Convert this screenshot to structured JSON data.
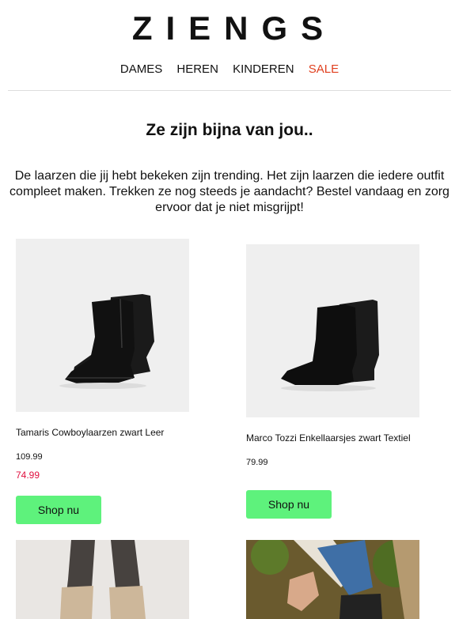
{
  "brand": {
    "logo": "ZIENGS"
  },
  "nav": {
    "items": [
      "DAMES",
      "HEREN",
      "KINDEREN",
      "SALE"
    ]
  },
  "headline": "Ze zijn bijna van jou..",
  "intro": "De laarzen die jij hebt bekeken zijn trending. Het zijn laarzen die iedere outfit compleet maken. Trekken ze nog steeds je aandacht? Bestel vandaag en zorg ervoor dat je niet misgrijpt!",
  "products": [
    {
      "name": "Tamaris Cowboylaarzen zwart Leer",
      "old_price": "109.99",
      "price": "74.99",
      "button": "Shop nu"
    },
    {
      "name": "Marco Tozzi Enkellaarsjes zwart Textiel",
      "price": "79.99",
      "button": "Shop nu"
    }
  ],
  "colors": {
    "sale": "#e0401f",
    "discount": "#e0103f",
    "button": "#5ef27c"
  }
}
